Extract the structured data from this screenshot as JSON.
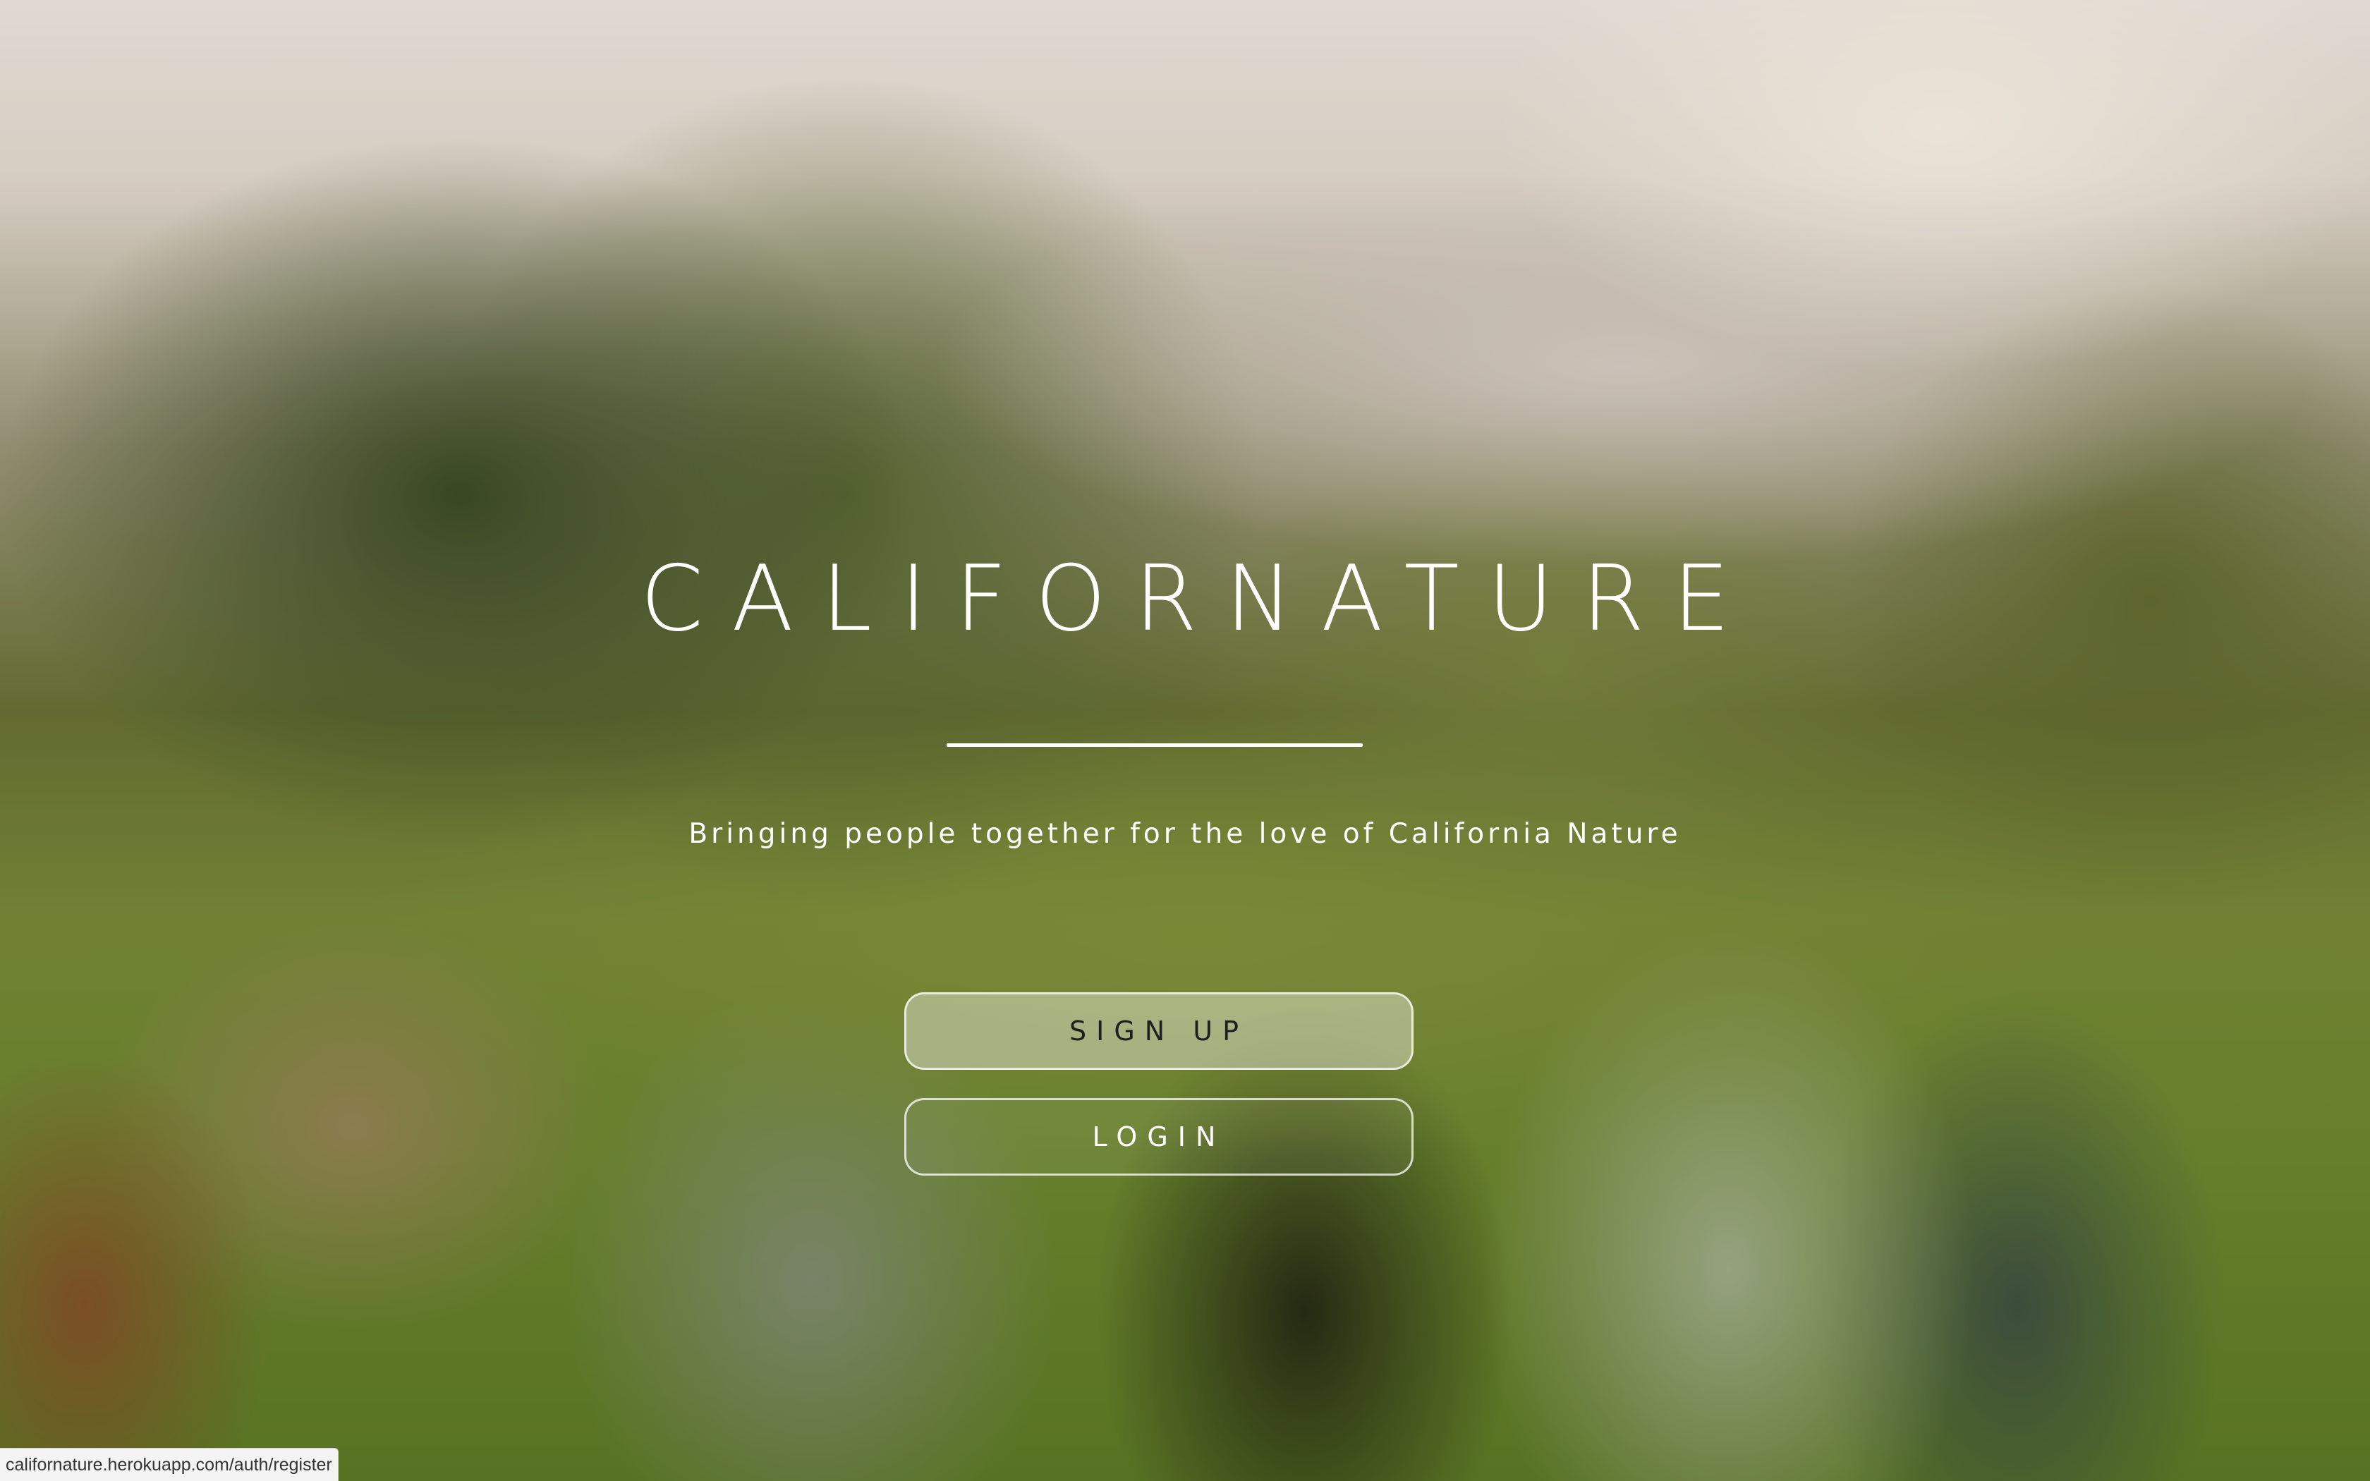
{
  "hero": {
    "title": "CALIFORNATURE",
    "tagline": "Bringing people together for the love of California Nature"
  },
  "buttons": {
    "signup_label": "SIGN UP",
    "login_label": "LOGIN"
  },
  "statusbar": {
    "url": "californature.herokuapp.com/auth/register"
  },
  "colors": {
    "text": "#ffffff",
    "signup_text": "#1f1f1f"
  }
}
